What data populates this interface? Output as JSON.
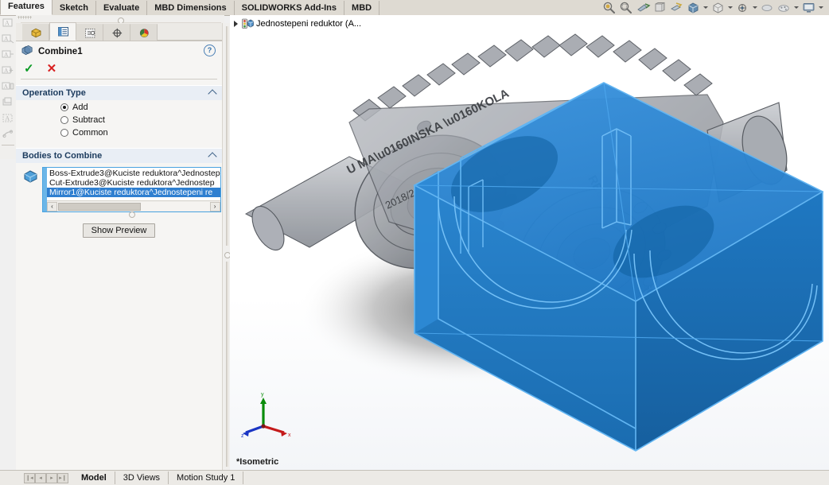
{
  "command_tabs": [
    {
      "label": "Features",
      "active": true
    },
    {
      "label": "Sketch",
      "active": false
    },
    {
      "label": "Evaluate",
      "active": false
    },
    {
      "label": "MBD Dimensions",
      "active": false
    },
    {
      "label": "SOLIDWORKS Add-Ins",
      "active": false
    },
    {
      "label": "MBD",
      "active": false
    }
  ],
  "view_toolbar": {
    "icons": [
      {
        "name": "zoom-to-fit-icon",
        "has_caret": false
      },
      {
        "name": "zoom-to-area-icon",
        "has_caret": false
      },
      {
        "name": "previous-view-icon",
        "has_caret": false
      },
      {
        "name": "section-view-icon",
        "has_caret": false
      },
      {
        "name": "view-orientation-icon",
        "has_caret": false
      },
      {
        "name": "display-style-icon",
        "has_caret": true
      },
      {
        "name": "hide-show-items-icon",
        "has_caret": true
      },
      {
        "name": "edit-appearance-icon",
        "has_caret": true
      },
      {
        "name": "apply-scene-icon",
        "has_caret": false
      },
      {
        "name": "view-settings-icon",
        "has_caret": true
      },
      {
        "name": "viewport-layout-icon",
        "has_caret": true
      }
    ]
  },
  "left_toolbar": {
    "icons": [
      "note-icon",
      "note-linked-icon",
      "balloon-icon",
      "auto-balloon-icon",
      "magnetic-line-icon",
      "surface-finish-icon",
      "weld-symbol-icon",
      "datum-feature-icon"
    ]
  },
  "property_manager": {
    "tabs": [
      {
        "name": "feature-manager-tree-tab",
        "active": false
      },
      {
        "name": "property-manager-tab",
        "active": true
      },
      {
        "name": "configuration-manager-tab",
        "active": false
      },
      {
        "name": "dimxpert-manager-tab",
        "active": false
      },
      {
        "name": "display-manager-tab",
        "active": false
      }
    ],
    "title": "Combine1",
    "help_label": "?",
    "ok_label": "✓",
    "cancel_label": "✕",
    "operation_type": {
      "header": "Operation Type",
      "options": [
        {
          "label": "Add",
          "selected": true
        },
        {
          "label": "Subtract",
          "selected": false
        },
        {
          "label": "Common",
          "selected": false
        }
      ]
    },
    "bodies_to_combine": {
      "header": "Bodies to Combine",
      "items": [
        {
          "text": "Boss-Extrude3@Kuciste reduktora^Jednostep",
          "selected": false
        },
        {
          "text": "Cut-Extrude3@Kuciste reduktora^Jednostep",
          "selected": false
        },
        {
          "text": "Mirror1@Kuciste reduktora^Jednostepeni re",
          "selected": true
        }
      ],
      "scroll_left_label": "‹",
      "scroll_right_label": "›"
    },
    "show_preview_label": "Show Preview"
  },
  "viewport": {
    "tree_root_label": "Jednostepeni reduktor  (A...",
    "orientation_label": "*Isometric",
    "triad": {
      "x_label": "x",
      "y_label": "y",
      "z_label": "z"
    },
    "colors": {
      "selected_body": "#1f7ac4",
      "selected_body_light": "#2f8fdd",
      "selected_edge": "#5cb3f0",
      "gear_gray": "#8b8e94",
      "shadow": "#4a4a4a",
      "background": "#ffffff"
    }
  },
  "status_bar": {
    "nav_buttons": [
      "❙◂",
      "◂",
      "▸",
      "▸❙"
    ],
    "tabs": [
      {
        "label": "Model",
        "active": true
      },
      {
        "label": "3D Views",
        "active": false
      },
      {
        "label": "Motion Study 1",
        "active": false
      }
    ]
  }
}
